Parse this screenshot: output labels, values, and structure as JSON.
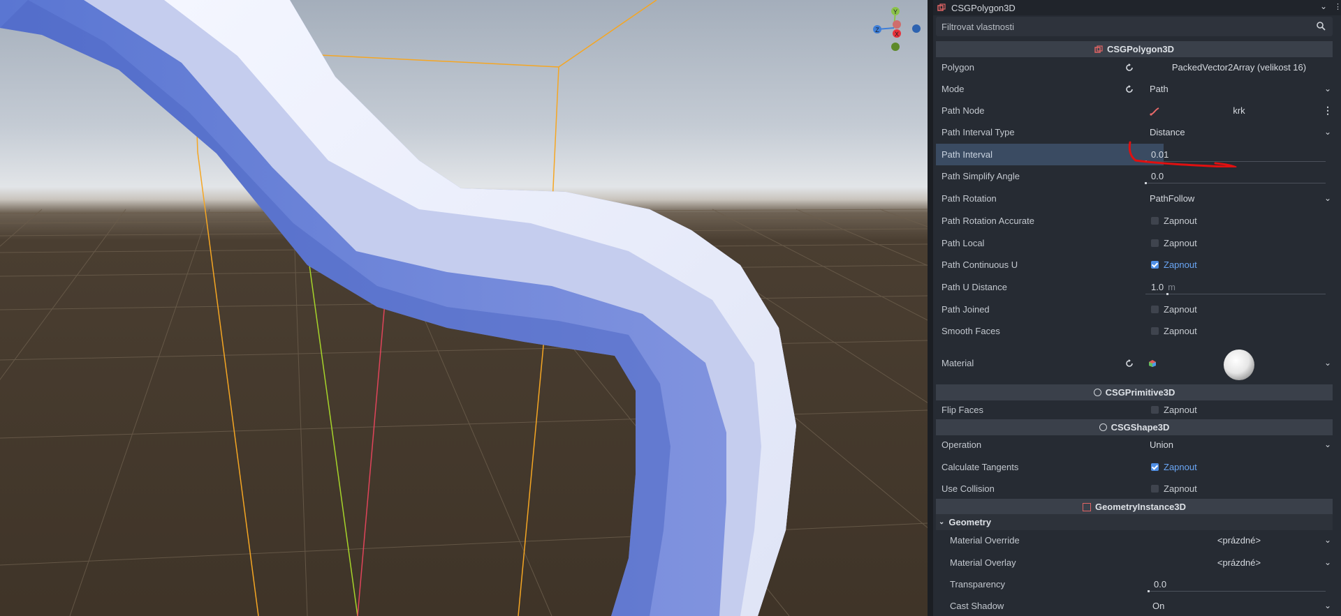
{
  "inspector": {
    "object_name": "CSGPolygon3D",
    "filter_placeholder": "Filtrovat vlastnosti",
    "sections": {
      "csg_polygon": "CSGPolygon3D",
      "csg_primitive": "CSGPrimitive3D",
      "csg_shape": "CSGShape3D",
      "geometry_instance": "GeometryInstance3D",
      "geometry_group": "Geometry"
    },
    "properties": {
      "polygon": {
        "label": "Polygon",
        "value": "PackedVector2Array (velikost 16)"
      },
      "mode": {
        "label": "Mode",
        "value": "Path"
      },
      "path_node": {
        "label": "Path Node",
        "value": "krk"
      },
      "path_interval_type": {
        "label": "Path Interval Type",
        "value": "Distance"
      },
      "path_interval": {
        "label": "Path Interval",
        "value": "0.01"
      },
      "path_simplify_angle": {
        "label": "Path Simplify Angle",
        "value": "0.0"
      },
      "path_rotation": {
        "label": "Path Rotation",
        "value": "PathFollow"
      },
      "path_rotation_accurate": {
        "label": "Path Rotation Accurate",
        "checked": false,
        "text": "Zapnout"
      },
      "path_local": {
        "label": "Path Local",
        "checked": false,
        "text": "Zapnout"
      },
      "path_continuous_u": {
        "label": "Path Continuous U",
        "checked": true,
        "text": "Zapnout"
      },
      "path_u_distance": {
        "label": "Path U Distance",
        "value": "1.0",
        "unit": "m"
      },
      "path_joined": {
        "label": "Path Joined",
        "checked": false,
        "text": "Zapnout"
      },
      "smooth_faces": {
        "label": "Smooth Faces",
        "checked": false,
        "text": "Zapnout"
      },
      "material": {
        "label": "Material"
      },
      "flip_faces": {
        "label": "Flip Faces",
        "checked": false,
        "text": "Zapnout"
      },
      "operation": {
        "label": "Operation",
        "value": "Union"
      },
      "calculate_tangents": {
        "label": "Calculate Tangents",
        "checked": true,
        "text": "Zapnout"
      },
      "use_collision": {
        "label": "Use Collision",
        "checked": false,
        "text": "Zapnout"
      },
      "material_override": {
        "label": "Material Override",
        "value": "<prázdné>"
      },
      "material_overlay": {
        "label": "Material Overlay",
        "value": "<prázdné>"
      },
      "transparency": {
        "label": "Transparency",
        "value": "0.0"
      },
      "cast_shadow": {
        "label": "Cast Shadow",
        "value": "On"
      }
    }
  },
  "gizmo": {
    "y": "Y",
    "z": "Z",
    "x": "X"
  },
  "colors": {
    "accent": "#4f8fe6",
    "annotation": "#e01010",
    "selection_box": "#f5a623"
  }
}
